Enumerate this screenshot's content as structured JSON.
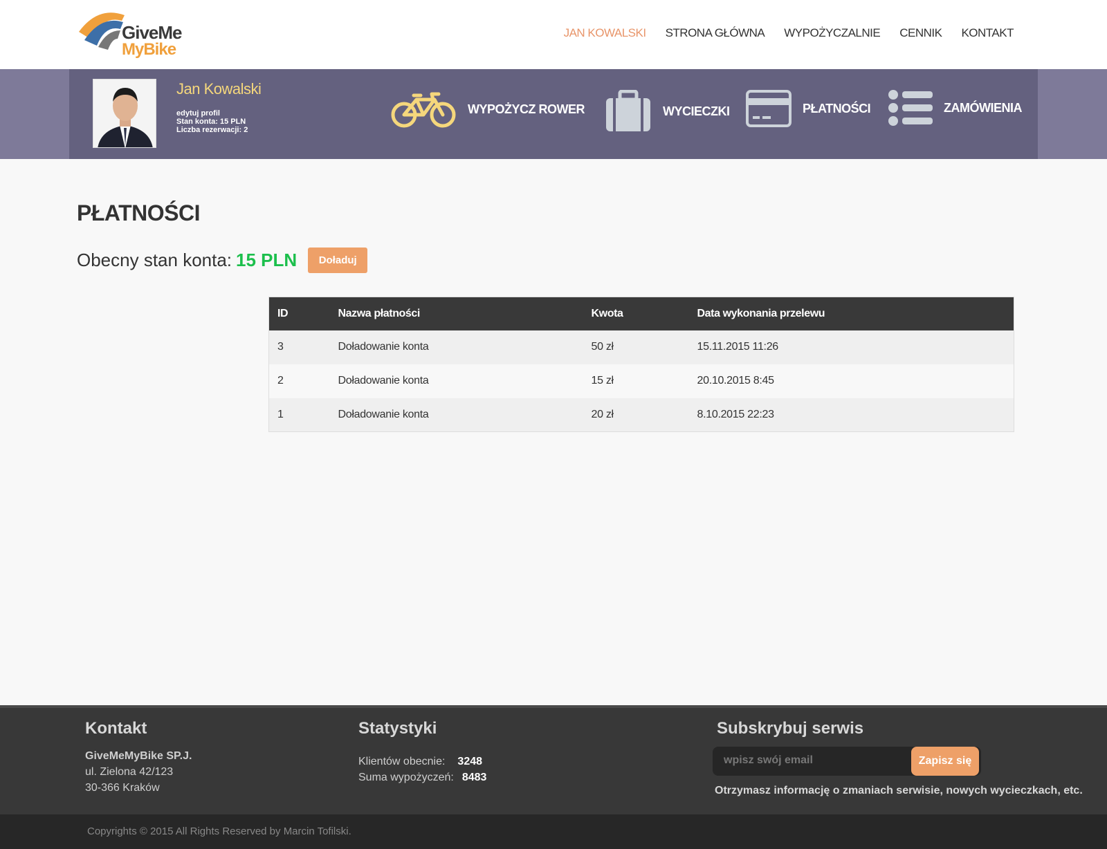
{
  "brand": {
    "line1": "GiveMe",
    "line2": "MyBike"
  },
  "nav": {
    "user": "JAN KOWALSKI",
    "home": "STRONA GŁÓWNA",
    "rentals": "WYPOŻYCZALNIE",
    "pricing": "CENNIK",
    "contact": "KONTAKT"
  },
  "user": {
    "name": "Jan Kowalski",
    "edit": "edytuj profil",
    "balance": "Stan konta:  15 PLN",
    "reservations": "Liczba rezerwacji: 2"
  },
  "quick": {
    "rent": "WYPOŻYCZ ROWER",
    "trips": "WYCIECZKI",
    "payments": "PŁATNOŚCI",
    "orders": "ZAMÓWIENIA"
  },
  "page": {
    "title": "PŁATNOŚCI",
    "balance_label": "Obecny stan konta:",
    "balance_value": "15 PLN",
    "topup": "Doładuj"
  },
  "table": {
    "headers": [
      "ID",
      "Nazwa płatności",
      "Kwota",
      "Data wykonania przelewu"
    ],
    "rows": [
      [
        "3",
        "Doładowanie konta",
        "50 zł",
        "15.11.2015 11:26"
      ],
      [
        "2",
        "Doładowanie konta",
        "15 zł",
        "20.10.2015 8:45"
      ],
      [
        "1",
        "Doładowanie konta",
        "20 zł",
        "8.10.2015 22:23"
      ]
    ]
  },
  "footer": {
    "contact_title": "Kontakt",
    "company": "GiveMeMyBike SP.J.",
    "street": "ul. Zielona 42/123",
    "city": "30-366 Kraków",
    "stats_title": "Statystyki",
    "stats_clients_label": "Klientów obecnie:",
    "stats_clients_value": "3248",
    "stats_rentals_label": "Suma wypożyczeń:",
    "stats_rentals_value": "8483",
    "subscribe_title": "Subskrybuj serwis",
    "subscribe_placeholder": "wpisz swój email",
    "subscribe_button": "Zapisz się",
    "subscribe_note": "Otrzymasz informację o zmaniach serwisie, nowych wycieczkach, etc.",
    "copyright": "Copyrights © 2015 All Rights Reserved by Marcin Tofilski."
  },
  "colors": {
    "accent": "#eea068",
    "banner": "#64617f",
    "balance_green": "#1cbf4c",
    "bike_icon": "#f5d77c"
  }
}
